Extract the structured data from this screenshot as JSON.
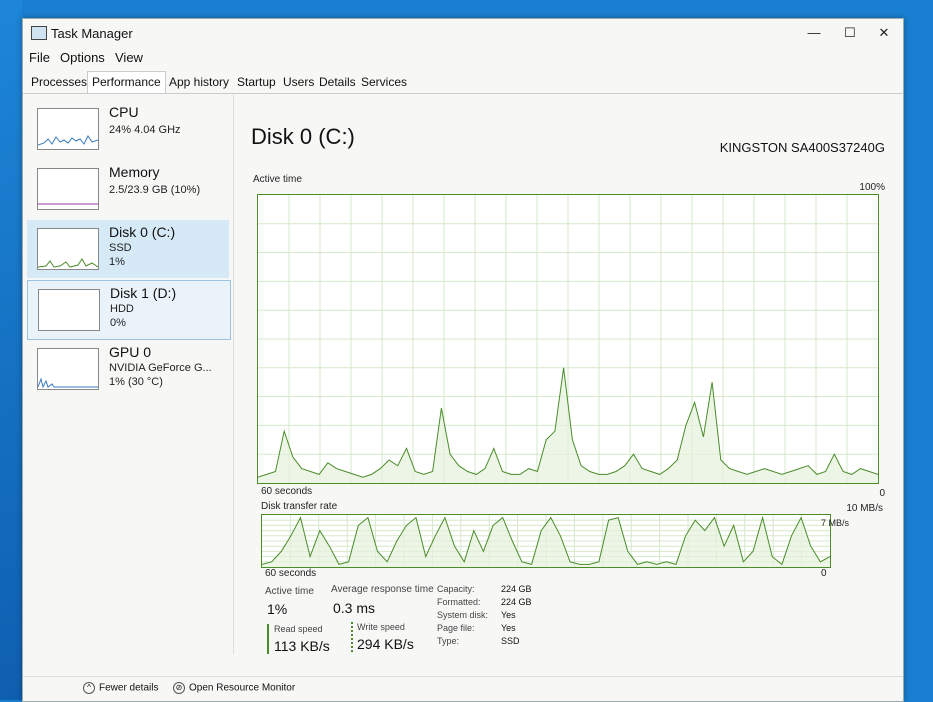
{
  "window": {
    "title": "Task Manager"
  },
  "menu": [
    "File",
    "Options",
    "View"
  ],
  "tabs": [
    "Processes",
    "Performance",
    "App history",
    "Startup",
    "Users",
    "Details",
    "Services"
  ],
  "sidebar": {
    "items": [
      {
        "name": "CPU",
        "line1": "24%  4.04 GHz",
        "line2": ""
      },
      {
        "name": "Memory",
        "line1": "2.5/23.9 GB (10%)",
        "line2": ""
      },
      {
        "name": "Disk 0 (C:)",
        "line1": "SSD",
        "line2": "1%"
      },
      {
        "name": "Disk 1 (D:)",
        "line1": "HDD",
        "line2": "0%"
      },
      {
        "name": "GPU 0",
        "line1": "NVIDIA GeForce G...",
        "line2": "1% (30 °C)"
      }
    ]
  },
  "main": {
    "title": "Disk 0 (C:)",
    "model": "KINGSTON SA400S37240G",
    "active_time_graph": {
      "label": "Active time",
      "max_label": "100%",
      "left_label": "60 seconds",
      "right_label": "0",
      "values": [
        2,
        3,
        4,
        18,
        9,
        5,
        4,
        3,
        7,
        5,
        4,
        3,
        2,
        3,
        5,
        8,
        6,
        12,
        4,
        3,
        4,
        26,
        10,
        6,
        4,
        3,
        5,
        12,
        4,
        3,
        3,
        5,
        4,
        15,
        18,
        40,
        15,
        6,
        4,
        3,
        3,
        4,
        6,
        10,
        5,
        4,
        3,
        5,
        8,
        20,
        28,
        16,
        35,
        8,
        5,
        4,
        3,
        4,
        5,
        4,
        3,
        4,
        5,
        6,
        3,
        4,
        10,
        4,
        3,
        5,
        4,
        3
      ]
    },
    "transfer_graph": {
      "label": "Disk transfer rate",
      "max_label": "10 MB/s",
      "secondary_label": "7 MB/s",
      "left_label": "60 seconds",
      "right_label": "0",
      "values": [
        5,
        10,
        30,
        60,
        95,
        20,
        70,
        40,
        5,
        10,
        80,
        95,
        30,
        10,
        50,
        80,
        95,
        20,
        60,
        95,
        40,
        10,
        70,
        30,
        80,
        95,
        50,
        10,
        5,
        70,
        95,
        60,
        10,
        5,
        5,
        10,
        90,
        95,
        30,
        5,
        10,
        5,
        10,
        5,
        60,
        90,
        70,
        95,
        40,
        80,
        10,
        30,
        95,
        20,
        5,
        60,
        95,
        40,
        10,
        20
      ]
    },
    "stats": {
      "active_time_label": "Active time",
      "active_time_value": "1%",
      "avg_response_label": "Average response time",
      "avg_response_value": "0.3 ms",
      "read_speed_label": "Read speed",
      "read_speed_value": "113 KB/s",
      "write_speed_label": "Write speed",
      "write_speed_value": "294 KB/s"
    },
    "specs": [
      {
        "label": "Capacity:",
        "value": "224 GB"
      },
      {
        "label": "Formatted:",
        "value": "224 GB"
      },
      {
        "label": "System disk:",
        "value": "Yes"
      },
      {
        "label": "Page file:",
        "value": "Yes"
      },
      {
        "label": "Type:",
        "value": "SSD"
      }
    ]
  },
  "footer": {
    "fewer_details": "Fewer details",
    "open_monitor": "Open Resource Monitor"
  },
  "colors": {
    "graph_line": "#4a8c2a",
    "selected_bg": "#d6e9f6"
  }
}
